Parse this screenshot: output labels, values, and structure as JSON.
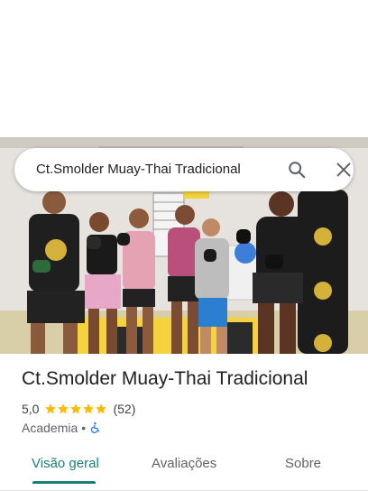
{
  "search": {
    "query": "Ct.Smolder Muay-Thai Tradicional"
  },
  "place": {
    "title": "Ct.Smolder Muay-Thai Tradicional",
    "rating": "5,0",
    "stars": 5,
    "review_count": "(52)",
    "category": "Academia",
    "separator": "•"
  },
  "tabs": [
    {
      "label": "Visão geral",
      "active": true
    },
    {
      "label": "Avaliações",
      "active": false
    },
    {
      "label": "Sobre",
      "active": false
    }
  ],
  "colors": {
    "accent": "#1a7f78",
    "star": "#fbbc04",
    "wheelchair": "#1a73e8"
  },
  "icons": {
    "search": "search-icon",
    "close": "close-icon",
    "wheelchair": "wheelchair-accessible-icon"
  }
}
